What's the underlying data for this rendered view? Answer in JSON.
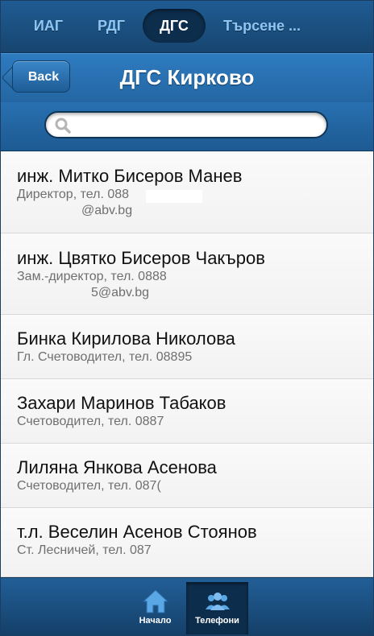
{
  "tabs": [
    {
      "label": "ИАГ",
      "active": false
    },
    {
      "label": "РДГ",
      "active": false
    },
    {
      "label": "ДГС",
      "active": true
    },
    {
      "label": "Търсене ...",
      "active": false
    }
  ],
  "header": {
    "back_label": "Back",
    "title": "ДГС Кирково"
  },
  "search": {
    "value": "",
    "placeholder": ""
  },
  "contacts": [
    {
      "name": "инж. Митко Бисеров Манев",
      "detail": "Директор, тел. 088",
      "email": "@abv.bg"
    },
    {
      "name": "инж. Цвятко Бисеров Чакъров",
      "detail": "Зам.-директор, тел. 0888",
      "email": "5@abv.bg"
    },
    {
      "name": "Бинка Кирилова Николова",
      "detail": "Гл. Счетоводител, тел. 08895"
    },
    {
      "name": "Захари Маринов Табаков",
      "detail": "Счетоводител, тел. 0887"
    },
    {
      "name": "Лиляна Янкова Асенова",
      "detail": "Счетоводител, тел. 087("
    },
    {
      "name": "т.л. Веселин Асенов Стоянов",
      "detail": "Ст. Лесничей, тел. 087"
    }
  ],
  "bottom_nav": [
    {
      "label": "Начало",
      "icon": "home-icon",
      "active": false
    },
    {
      "label": "Телефони",
      "icon": "users-icon",
      "active": true
    }
  ],
  "colors": {
    "bar_dark": "#17456f",
    "header_blue": "#2a70b0",
    "tab_text": "#8fc6f2",
    "active_bg": "#0d2d4c"
  }
}
